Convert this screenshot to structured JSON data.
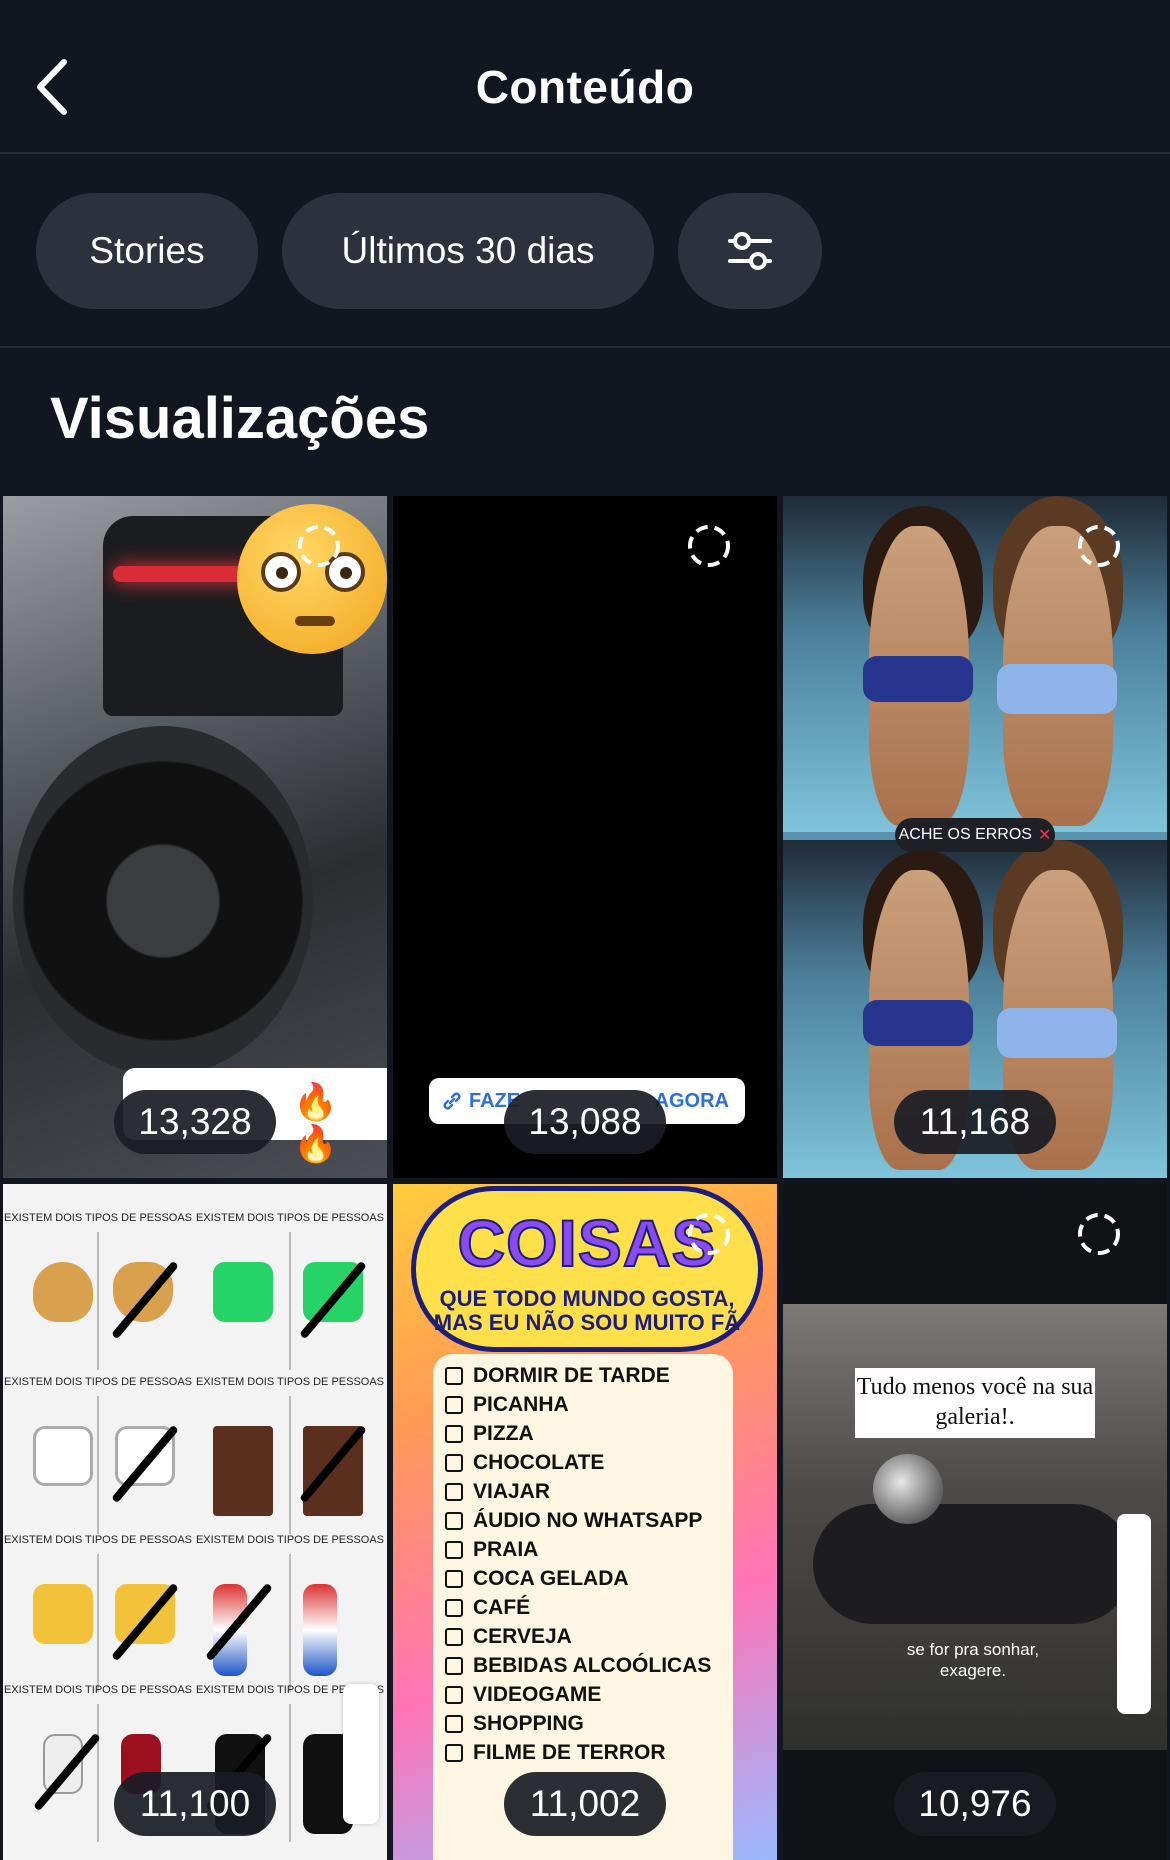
{
  "header": {
    "title": "Conteúdo"
  },
  "filters": {
    "type": "Stories",
    "period": "Últimos 30 dias",
    "settings_icon": "sliders-icon"
  },
  "section": {
    "title": "Visualizações"
  },
  "stories": [
    {
      "views": "13,328",
      "overlay_text": ""
    },
    {
      "views": "13,088",
      "overlay_text": ""
    },
    {
      "views": "11,168",
      "overlay_text": "ACHE OS ERROS"
    },
    {
      "views": "11,100",
      "overlay_text": ""
    },
    {
      "views": "11,002",
      "overlay_text": ""
    },
    {
      "views": "10,976",
      "overlay_text": ""
    }
  ],
  "story_texts": {
    "tile1_caption_icons": "🔥 🔥",
    "tile2_cta_left": "FAZE",
    "tile2_cta_right": "AGORA",
    "tile4_cell_titles": [
      "EXISTEM DOIS TIPOS DE PESSOAS",
      "EXISTEM DOIS TIPOS DE PESSOAS",
      "EXISTEM DOIS TIPOS DE PESSOAS",
      "EXISTEM DOIS TIPOS DE PESSOAS",
      "EXISTEM DOIS TIPOS DE PESSOAS",
      "EXISTEM DOIS TIPOS DE PESSOAS",
      "EXISTEM DOIS TIPOS DE PESSOAS",
      "EXISTEM DOIS TIPOS DE PESSOAS"
    ],
    "tile5_title": "COISAS",
    "tile5_subtitle_1": "QUE TODO MUNDO GOSTA,",
    "tile5_subtitle_2": "MAS EU NÃO SOU MUITO FÃ",
    "tile5_items": [
      "DORMIR DE TARDE",
      "PICANHA",
      "PIZZA",
      "CHOCOLATE",
      "VIAJAR",
      "ÁUDIO NO WHATSAPP",
      "PRAIA",
      "COCA GELADA",
      "CAFÉ",
      "CERVEJA",
      "BEBIDAS ALCOÓLICAS",
      "VIDEOGAME",
      "SHOPPING",
      "FILME DE TERROR"
    ],
    "tile6_card": "Tudo menos você na sua galeria!.",
    "tile6_caption": "se for pra sonhar, exagere."
  },
  "colors": {
    "background": "#121620",
    "pill": "#2c313d",
    "badge": "#191c24"
  }
}
